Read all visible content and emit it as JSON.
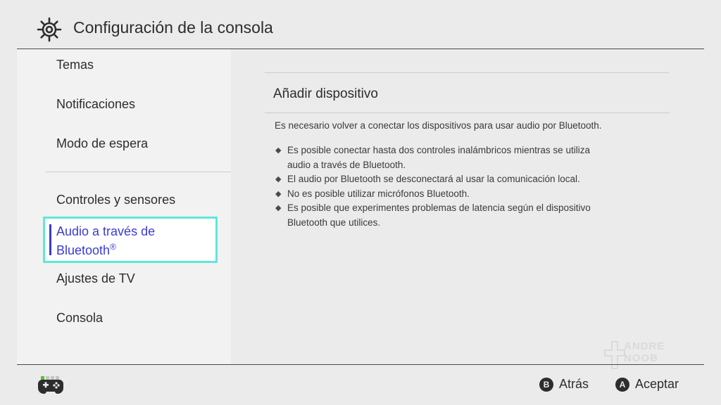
{
  "header": {
    "title": "Configuración de la consola",
    "icon": "gear-icon"
  },
  "sidebar": {
    "items": [
      {
        "label": "Temas"
      },
      {
        "label": "Notificaciones"
      },
      {
        "label": "Modo de espera"
      },
      {
        "label": "Controles y sensores"
      },
      {
        "label": "Audio a través de",
        "label2": "Bluetooth",
        "mark": "®",
        "selected": true
      },
      {
        "label": "Ajustes de TV"
      },
      {
        "label": "Consola"
      }
    ]
  },
  "content": {
    "title": "Añadir dispositivo",
    "intro": "Es necesario volver a conectar los dispositivos para usar audio por Bluetooth.",
    "bullets": [
      {
        "line1": "Es posible conectar hasta dos controles inalámbricos mientras se utiliza",
        "line2": "audio a través de Bluetooth."
      },
      {
        "line1": "El audio por Bluetooth se desconectará al usar la comunicación local."
      },
      {
        "line1": "No es posible utilizar micrófonos Bluetooth."
      },
      {
        "line1": "Es posible que experimentes problemas de latencia según el dispositivo",
        "line2": "Bluetooth que utilices."
      }
    ],
    "bullet_glyph": "◆"
  },
  "footer": {
    "controller_icon": "controller-icon",
    "back": {
      "key": "B",
      "label": "Atrás"
    },
    "accept": {
      "key": "A",
      "label": "Aceptar"
    }
  },
  "watermark": {
    "line1": "ANDRE",
    "line2": "NOOB"
  },
  "colors": {
    "background": "#ebebeb",
    "sidebar": "#f2f2f2",
    "selection_border": "#5fe8d9",
    "selection_text": "#3b3bd4",
    "text": "#2d2d2d"
  }
}
